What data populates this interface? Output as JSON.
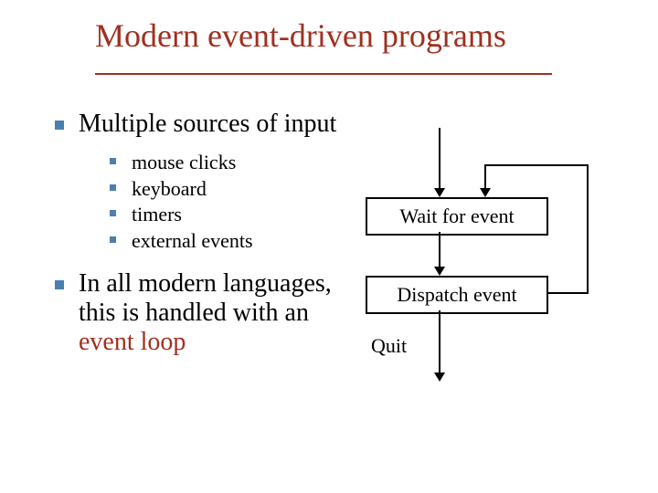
{
  "title": "Modern event-driven programs",
  "bullets": {
    "multiple_sources": "Multiple sources of input",
    "subs": {
      "mouse": "mouse clicks",
      "keyboard": "keyboard",
      "timers": "timers",
      "external": "external events"
    },
    "modern_prefix": "In all modern languages, this is handled with an ",
    "modern_red": "event loop"
  },
  "diagram": {
    "wait": "Wait for event",
    "dispatch": "Dispatch event",
    "quit": "Quit"
  },
  "chart_data": {
    "type": "flowchart",
    "nodes": [
      {
        "id": "wait",
        "label": "Wait for event"
      },
      {
        "id": "dispatch",
        "label": "Dispatch event"
      },
      {
        "id": "quit",
        "label": "Quit"
      }
    ],
    "edges": [
      {
        "from": "start",
        "to": "wait"
      },
      {
        "from": "wait",
        "to": "dispatch"
      },
      {
        "from": "dispatch",
        "to": "wait",
        "loop": true
      },
      {
        "from": "dispatch",
        "to": "quit"
      }
    ]
  }
}
